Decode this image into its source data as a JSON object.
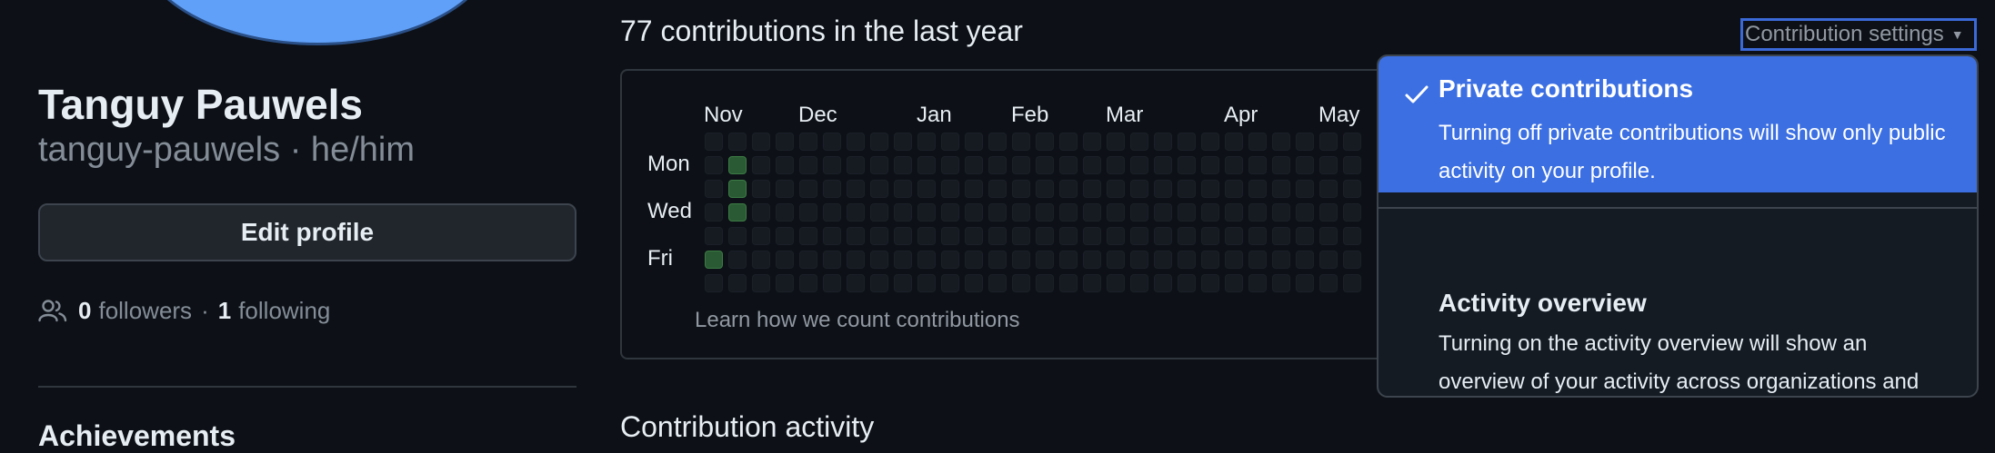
{
  "profile": {
    "name": "Tanguy Pauwels",
    "login_line": "tanguy-pauwels · he/him",
    "edit_label": "Edit profile",
    "followers_count": "0",
    "followers_label": "followers",
    "separator": "·",
    "following_count": "1",
    "following_label": "following",
    "achievements_heading": "Achievements"
  },
  "contributions": {
    "title": "77 contributions in the last year",
    "settings_label": "Contribution settings",
    "months": [
      "Nov",
      "Dec",
      "Jan",
      "Feb",
      "Mar",
      "Apr",
      "May"
    ],
    "days": [
      "Mon",
      "Wed",
      "Fri"
    ],
    "learn_link": "Learn how we count contributions",
    "activity_heading": "Contribution activity"
  },
  "dropdown": {
    "options": [
      {
        "title": "Private contributions",
        "description": "Turning off private contributions will show only public activity on your profile.",
        "selected": true
      },
      {
        "title": "Activity overview",
        "description": "Turning on the activity overview will show an overview of your activity across organizations and repositories.",
        "selected": false
      }
    ]
  },
  "colors": {
    "accent": "#3b6fe2",
    "background": "#0d1117",
    "contribution_level1": "#2a5a33"
  }
}
